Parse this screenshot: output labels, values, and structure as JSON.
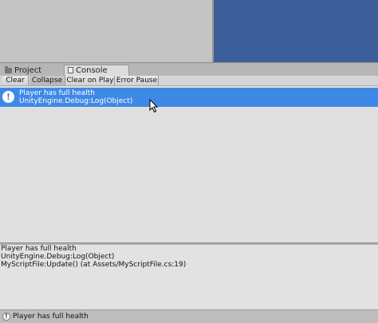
{
  "colors": {
    "selection": "#3f89e6",
    "scene_background": "#3c5f9a",
    "log_background": "#dfdfdf"
  },
  "tabs": [
    {
      "label": "Project",
      "icon": "folder-icon"
    },
    {
      "label": "Console",
      "icon": "console-icon",
      "active": true
    }
  ],
  "toolbar": {
    "buttons": [
      {
        "label": "Clear",
        "active": false
      },
      {
        "label": "Collapse",
        "active": true
      },
      {
        "label": "Clear on Play",
        "active": false
      },
      {
        "label": "Error Pause",
        "active": false
      }
    ]
  },
  "log": {
    "entries": [
      {
        "icon": "info-icon",
        "message": "Player has full health",
        "source": "UnityEngine.Debug:Log(Object)",
        "selected": true
      }
    ]
  },
  "details": {
    "lines": [
      "Player has full health",
      "UnityEngine.Debug:Log(Object)",
      "MyScriptFile:Update() (at Assets/MyScriptFile.cs:19)"
    ]
  },
  "status": {
    "icon": "info-icon",
    "text": "Player has full health"
  }
}
